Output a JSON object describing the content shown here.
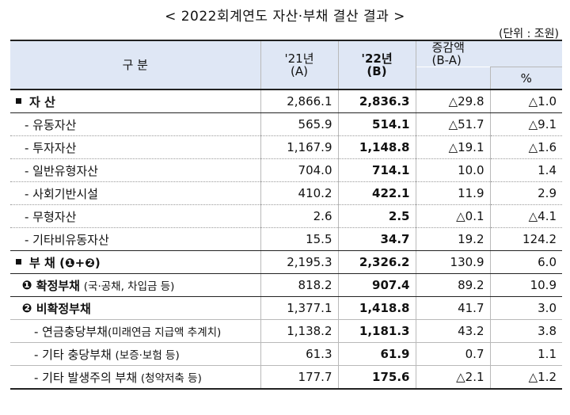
{
  "title": "< 2022회계연도 자산·부채 결산 결과 >",
  "unit": "(단위 : 조원)",
  "header": {
    "category": "구    분",
    "y21_line1": "'21년",
    "y21_line2": "(A)",
    "y22_line1": "'22년",
    "y22_line2": "(B)",
    "diff_line1": "증감액",
    "diff_line2": "(B-A)",
    "pct": "%"
  },
  "rows": [
    {
      "label": "자    산",
      "a": "2,866.1",
      "b": "2,836.3",
      "diff": "△29.8",
      "pct": "△1.0"
    },
    {
      "label": "- 유동자산",
      "a": "565.9",
      "b": "514.1",
      "diff": "△51.7",
      "pct": "△9.1"
    },
    {
      "label": "- 투자자산",
      "a": "1,167.9",
      "b": "1,148.8",
      "diff": "△19.1",
      "pct": "△1.6"
    },
    {
      "label": "- 일반유형자산",
      "a": "704.0",
      "b": "714.1",
      "diff": "10.0",
      "pct": "1.4"
    },
    {
      "label": "- 사회기반시설",
      "a": "410.2",
      "b": "422.1",
      "diff": "11.9",
      "pct": "2.9"
    },
    {
      "label": "- 무형자산",
      "a": "2.6",
      "b": "2.5",
      "diff": "△0.1",
      "pct": "△4.1"
    },
    {
      "label": "- 기타비유동자산",
      "a": "15.5",
      "b": "34.7",
      "diff": "19.2",
      "pct": "124.2"
    },
    {
      "label": "부    채",
      "label_sub": "(❶+❷)",
      "a": "2,195.3",
      "b": "2,326.2",
      "diff": "130.9",
      "pct": "6.0"
    },
    {
      "marker": "❶",
      "label": "확정부채",
      "label_sub": "(국·공채, 차입금 등)",
      "a": "818.2",
      "b": "907.4",
      "diff": "89.2",
      "pct": "10.9"
    },
    {
      "marker": "❷",
      "label": "비확정부채",
      "a": "1,377.1",
      "b": "1,418.8",
      "diff": "41.7",
      "pct": "3.0"
    },
    {
      "label": "- 연금충당부채",
      "label_sub": "(미래연금 지급액 추계치)",
      "a": "1,138.2",
      "b": "1,181.3",
      "diff": "43.2",
      "pct": "3.8"
    },
    {
      "label": "- 기타 충당부채",
      "label_sub": "(보증·보험 등)",
      "a": "61.3",
      "b": "61.9",
      "diff": "0.7",
      "pct": "1.1"
    },
    {
      "label": "- 기타 발생주의 부채",
      "label_sub": "(청약저축 등)",
      "a": "177.7",
      "b": "175.6",
      "diff": "△2.1",
      "pct": "△1.2"
    }
  ]
}
